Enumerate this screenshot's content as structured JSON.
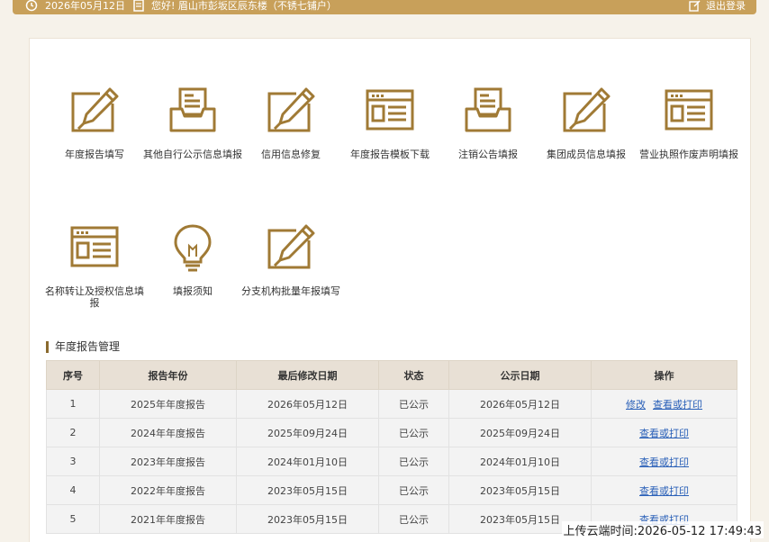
{
  "topbar": {
    "date": "2026年05月12日",
    "greeting": "您好! 眉山市彭坂区辰东楼（不锈七铺户）",
    "logout_label": "退出登录",
    "date_icon": "clock-icon",
    "greeting_icon": "document-icon",
    "logout_icon": "edit-out-icon"
  },
  "tiles": [
    {
      "label": "年度报告填写",
      "icon": "pen-board-icon"
    },
    {
      "label": "其他自行公示信息填报",
      "icon": "tray-document-icon"
    },
    {
      "label": "信用信息修复",
      "icon": "pen-board-icon"
    },
    {
      "label": "年度报告模板下载",
      "icon": "browser-window-icon"
    },
    {
      "label": "注销公告填报",
      "icon": "tray-document-icon"
    },
    {
      "label": "集团成员信息填报",
      "icon": "pen-board-icon"
    },
    {
      "label": "营业执照作废声明填报",
      "icon": "browser-window-icon"
    },
    {
      "label": "名称转让及授权信息填报",
      "icon": "browser-window-icon"
    },
    {
      "label": "填报须知",
      "icon": "lightbulb-icon"
    },
    {
      "label": "分支机构批量年报填写",
      "icon": "pen-board-icon"
    }
  ],
  "section": {
    "title": "年度报告管理"
  },
  "table": {
    "headers": [
      "序号",
      "报告年份",
      "最后修改日期",
      "状态",
      "公示日期",
      "操作"
    ],
    "rows": [
      {
        "no": "1",
        "year": "2025年年度报告",
        "modified": "2026年05月12日",
        "status": "已公示",
        "published": "2026年05月12日",
        "edit": "修改",
        "view": "查看或打印"
      },
      {
        "no": "2",
        "year": "2024年年度报告",
        "modified": "2025年09月24日",
        "status": "已公示",
        "published": "2025年09月24日",
        "edit": "",
        "view": "查看或打印"
      },
      {
        "no": "3",
        "year": "2023年年度报告",
        "modified": "2024年01月10日",
        "status": "已公示",
        "published": "2024年01月10日",
        "edit": "",
        "view": "查看或打印"
      },
      {
        "no": "4",
        "year": "2022年年度报告",
        "modified": "2023年05月15日",
        "status": "已公示",
        "published": "2023年05月15日",
        "edit": "",
        "view": "查看或打印"
      },
      {
        "no": "5",
        "year": "2021年年度报告",
        "modified": "2023年05月15日",
        "status": "已公示",
        "published": "2023年05月15日",
        "edit": "",
        "view": "查看或打印"
      }
    ]
  },
  "watermark": "上传云端时间:2026-05-12 17:49:43",
  "colors": {
    "accent": "#a07a35",
    "topbar": "#c8a05a",
    "link": "#2a60b8"
  }
}
